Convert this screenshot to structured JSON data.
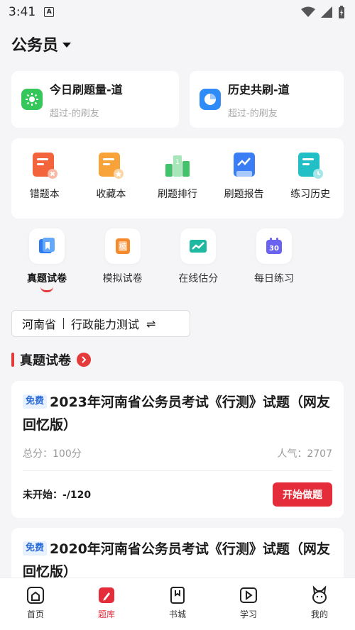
{
  "status": {
    "time": "3:41"
  },
  "header": {
    "title": "公务员"
  },
  "stats": [
    {
      "title": "今日刷题量-道",
      "sub": "超过-的刷友",
      "icon": "sun-icon",
      "color": "#35c759"
    },
    {
      "title": "历史共刷-道",
      "sub": "超过-的刷友",
      "icon": "pie-chart-icon",
      "color": "#2f8cf6"
    }
  ],
  "tools": [
    {
      "label": "错题本",
      "icon": "wrong-book-icon",
      "color": "#f4643c"
    },
    {
      "label": "收藏本",
      "icon": "favorite-book-icon",
      "color": "#f8a23a"
    },
    {
      "label": "刷题排行",
      "icon": "ranking-icon",
      "color": "#41c36b"
    },
    {
      "label": "刷题报告",
      "icon": "report-icon",
      "color": "#3a7df4"
    },
    {
      "label": "练习历史",
      "icon": "history-icon",
      "color": "#22c0c6"
    }
  ],
  "categories": [
    {
      "label": "真题试卷",
      "icon": "real-exam-icon",
      "active": true
    },
    {
      "label": "模拟试卷",
      "icon": "mock-exam-icon"
    },
    {
      "label": "在线估分",
      "icon": "score-estimate-icon"
    },
    {
      "label": "每日练习",
      "icon": "daily-practice-icon",
      "badge": "30"
    }
  ],
  "region": {
    "province": "河南省",
    "subject": "行政能力测试",
    "swap_symbol": "⇌"
  },
  "section": {
    "title": "真题试卷"
  },
  "papers": [
    {
      "tag": "免费",
      "title": "2023年河南省公务员考试《行测》试题（网友回忆版）",
      "total": "总分：100分",
      "popularity": "人气：2707",
      "progress": "未开始：-/120",
      "button": "开始做题"
    },
    {
      "tag": "免费",
      "title": "2020年河南省公务员考试《行测》试题（网友回忆版）"
    }
  ],
  "tabbar": [
    {
      "label": "首页",
      "icon": "home-icon"
    },
    {
      "label": "题库",
      "icon": "question-bank-icon",
      "active": true
    },
    {
      "label": "书城",
      "icon": "bookstore-icon"
    },
    {
      "label": "学习",
      "icon": "study-play-icon"
    },
    {
      "label": "我的",
      "icon": "profile-rabbit-icon"
    }
  ]
}
